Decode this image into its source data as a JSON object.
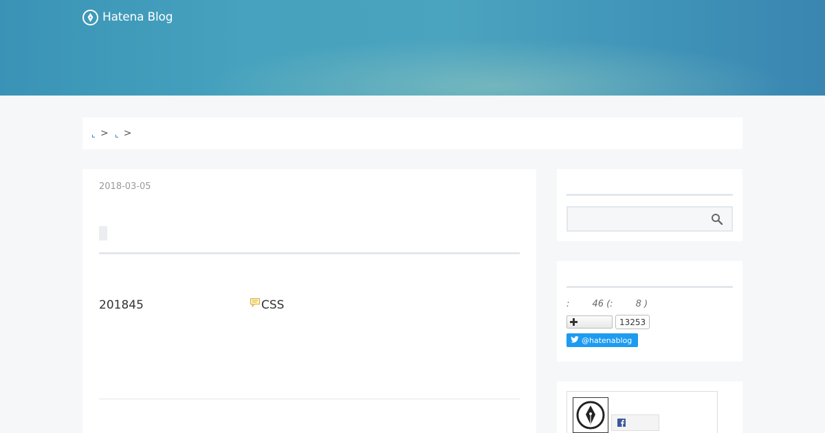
{
  "header": {
    "logo_text": "Hatena Blog",
    "background_color": "#4aa3bf"
  },
  "breadcrumb": {
    "separator_1": ">",
    "separator_2": ">"
  },
  "entry": {
    "date": "2018-03-05",
    "body_text": "201845",
    "tag_text": "CSS"
  },
  "sidebar": {
    "search": {
      "placeholder": ""
    },
    "readers": {
      "stats_text": ":        46 (:        8 )",
      "follow_count": "13253",
      "twitter_handle": "@hatenablog",
      "twitter_color": "#1d9bf0"
    }
  }
}
